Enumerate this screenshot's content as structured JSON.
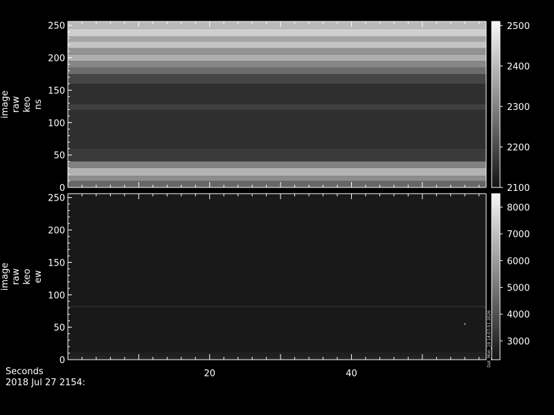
{
  "chart_data": [
    {
      "type": "heatmap",
      "ylabel": [
        "image",
        "raw",
        "keo",
        "ns"
      ],
      "xlim": [
        0,
        59
      ],
      "ylim": [
        0,
        256
      ],
      "y_ticks": [
        0,
        50,
        100,
        150,
        200,
        250
      ],
      "colorbar": {
        "min": 2100,
        "max": 2510,
        "ticks": [
          2100,
          2200,
          2300,
          2400,
          2500
        ]
      },
      "bands": [
        {
          "y": [
            0,
            10
          ],
          "value": 2250
        },
        {
          "y": [
            10,
            18
          ],
          "value": 2320
        },
        {
          "y": [
            18,
            30
          ],
          "value": 2390
        },
        {
          "y": [
            30,
            40
          ],
          "value": 2300
        },
        {
          "y": [
            40,
            60
          ],
          "value": 2170
        },
        {
          "y": [
            60,
            120
          ],
          "value": 2150
        },
        {
          "y": [
            120,
            128
          ],
          "value": 2180
        },
        {
          "y": [
            128,
            160
          ],
          "value": 2150
        },
        {
          "y": [
            160,
            175
          ],
          "value": 2190
        },
        {
          "y": [
            175,
            185
          ],
          "value": 2260
        },
        {
          "y": [
            185,
            195
          ],
          "value": 2310
        },
        {
          "y": [
            195,
            205
          ],
          "value": 2380
        },
        {
          "y": [
            205,
            215
          ],
          "value": 2330
        },
        {
          "y": [
            215,
            225
          ],
          "value": 2420
        },
        {
          "y": [
            225,
            233
          ],
          "value": 2360
        },
        {
          "y": [
            233,
            245
          ],
          "value": 2440
        },
        {
          "y": [
            245,
            256
          ],
          "value": 2400
        }
      ]
    },
    {
      "type": "heatmap",
      "ylabel": [
        "image",
        "raw",
        "keo",
        "ew"
      ],
      "xlim": [
        0,
        59
      ],
      "ylim": [
        0,
        256
      ],
      "y_ticks": [
        0,
        50,
        100,
        150,
        200,
        250
      ],
      "x_ticks": [
        20,
        40
      ],
      "colorbar": {
        "min": 2300,
        "max": 8500,
        "ticks": [
          3000,
          4000,
          5000,
          6000,
          7000,
          8000
        ]
      },
      "colorbar_annotation": "Dat_Mon_19 14:07:51 2026",
      "bands": [
        {
          "y": [
            0,
            6
          ],
          "value": 2700
        },
        {
          "y": [
            6,
            12
          ],
          "value": 2600
        },
        {
          "y": [
            12,
            81
          ],
          "value": 2450
        },
        {
          "y": [
            81,
            83
          ],
          "value": 3000
        },
        {
          "y": [
            83,
            256
          ],
          "value": 2450
        }
      ],
      "points": [
        {
          "x": 56,
          "y": 55,
          "value": 6500
        }
      ]
    }
  ],
  "footer": {
    "xlabel": "Seconds",
    "date": "2018 Jul 27 2154:"
  }
}
